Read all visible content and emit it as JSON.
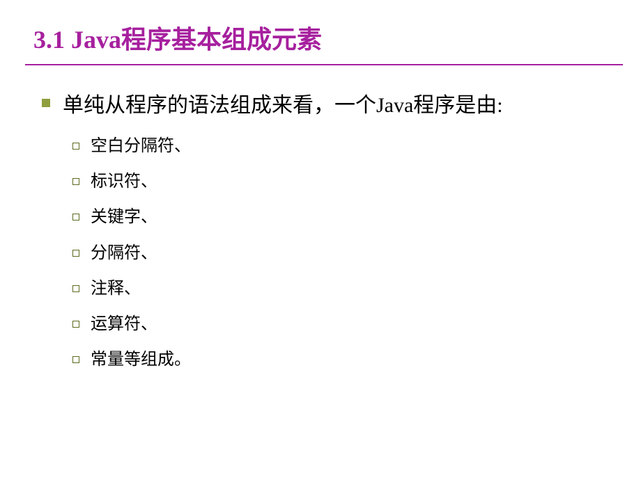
{
  "title": "3.1  Java程序基本组成元素",
  "main_item": "单纯从程序的语法组成来看，一个Java程序是由:",
  "sub_items": [
    "空白分隔符、",
    "标识符、",
    "关键字、",
    "分隔符、",
    "注释、",
    "运算符、",
    "常量等组成。"
  ]
}
